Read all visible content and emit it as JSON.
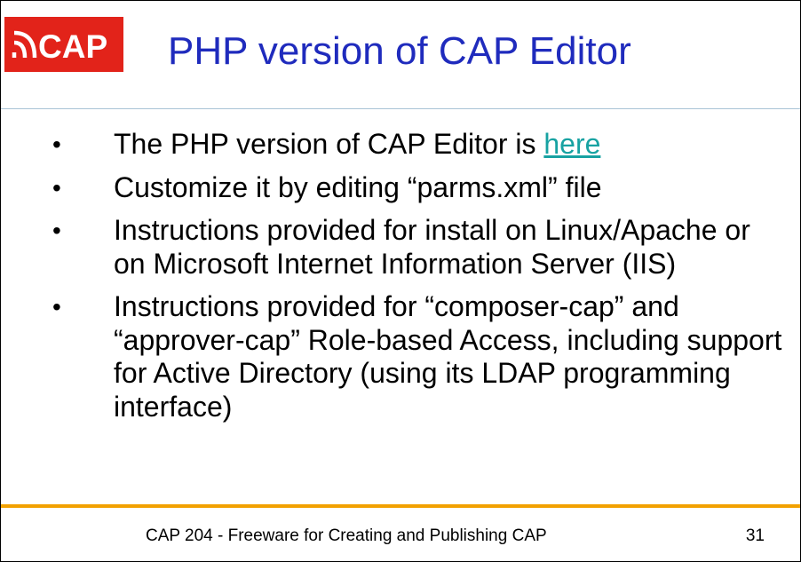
{
  "logo": {
    "text": "CAP",
    "background": "#e2231a",
    "icon": "broadcast-waves-icon"
  },
  "title": "PHP version of CAP Editor",
  "colors": {
    "title": "#1f2bbd",
    "link": "#17a2a2",
    "footer_rule": "#f2a100",
    "title_rule": "#a9c3d6"
  },
  "bullets": [
    {
      "text": "The PHP version of CAP Editor is ",
      "link_text": "here"
    },
    {
      "text": "Customize it by editing “parms.xml” file"
    },
    {
      "text": "Instructions provided for install on Linux/Apache or on Microsoft Internet Information Server (IIS)"
    },
    {
      "text": "Instructions provided for “composer-cap” and “approver-cap” Role-based Access, including support for Active Directory (using its LDAP programming interface)"
    }
  ],
  "bullet_symbol": "•",
  "footer": {
    "text": "CAP 204 - Freeware for Creating and Publishing CAP",
    "page_number": "31"
  }
}
